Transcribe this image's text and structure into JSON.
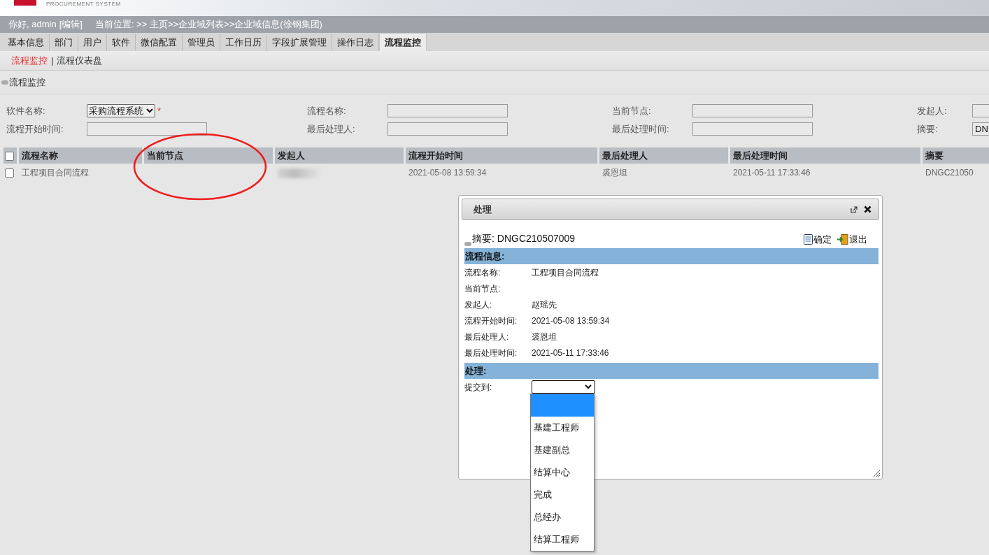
{
  "header": {
    "subtitle": "PROCUREMENT SYSTEM"
  },
  "user_bar": {
    "greeting": "你好, admin",
    "edit_link": "[编辑]",
    "breadcrumb": "当前位置: >> 主页>>企业域列表>>企业域信息(徐钢集团)"
  },
  "tabs": [
    {
      "label": "基本信息",
      "selected": false
    },
    {
      "label": "部门",
      "selected": false
    },
    {
      "label": "用户",
      "selected": false
    },
    {
      "label": "软件",
      "selected": false
    },
    {
      "label": "微信配置",
      "selected": false
    },
    {
      "label": "管理员",
      "selected": false
    },
    {
      "label": "工作日历",
      "selected": false
    },
    {
      "label": "字段扩展管理",
      "selected": false
    },
    {
      "label": "操作日志",
      "selected": false
    },
    {
      "label": "流程监控",
      "selected": true
    }
  ],
  "subnav": {
    "separator": "|",
    "items": [
      {
        "label": "流程监控",
        "selected": true
      },
      {
        "label": "流程仪表盘",
        "selected": false
      }
    ]
  },
  "page_title": "流程监控",
  "filters": [
    {
      "label": "软件名称:",
      "kind": "select",
      "value": "采购流程系统",
      "required": true,
      "required_mark": "*"
    },
    {
      "label": "流程名称:",
      "kind": "input"
    },
    {
      "label": "当前节点:",
      "kind": "input"
    },
    {
      "label": "发起人:",
      "kind": "input"
    },
    {
      "label": "流程开始时间:",
      "kind": "input"
    },
    {
      "label": "最后处理人:",
      "kind": "input"
    },
    {
      "label": "最后处理时间:",
      "kind": "input"
    },
    {
      "label": "摘要:",
      "kind": "input",
      "value": "DN"
    }
  ],
  "table": {
    "header_checked": false,
    "columns": [
      "流程名称",
      "当前节点",
      "发起人",
      "流程开始时间",
      "最后处理人",
      "最后处理时间",
      "摘要"
    ],
    "rows": [
      {
        "checked": false,
        "cells": [
          {
            "kind": "text",
            "text": "工程项目合同流程"
          },
          {
            "kind": "empty"
          },
          {
            "kind": "blurred"
          },
          {
            "kind": "text",
            "text": "2021-05-08 13:59:34"
          },
          {
            "kind": "text",
            "text": "裘恩坦"
          },
          {
            "kind": "text",
            "text": "2021-05-11 17:33:46"
          },
          {
            "kind": "text",
            "text": "DNGC21050"
          }
        ]
      }
    ]
  },
  "annotation": {
    "kind": "ellipse",
    "color": "#ee1c1c"
  },
  "dialog": {
    "title": "处理",
    "summary_label": "摘要:",
    "summary": "DNGC210507009",
    "actions": [
      {
        "kind": "save",
        "label": "确定"
      },
      {
        "kind": "exit",
        "label": "退出"
      }
    ],
    "sections": [
      {
        "title": "流程信息:",
        "fields": [
          {
            "label": "流程名称:",
            "value": "工程项目合同流程"
          },
          {
            "label": "当前节点:"
          },
          {
            "label": "发起人:",
            "value": "赵瑶先"
          },
          {
            "label": "流程开始时间:",
            "value": "2021-05-08 13:59:34"
          },
          {
            "label": "最后处理人:",
            "value": "裘恩坦"
          },
          {
            "label": "最后处理时间:",
            "value": "2021-05-11 17:33:46"
          }
        ]
      },
      {
        "title": "处理:"
      }
    ],
    "submit": {
      "label": "提交到:",
      "expanded": true,
      "options": [
        {
          "selected": true
        },
        {
          "label": "基建工程师",
          "selected": false
        },
        {
          "label": "基建副总",
          "selected": false
        },
        {
          "label": "结算中心",
          "selected": false
        },
        {
          "label": "完成",
          "selected": false
        },
        {
          "label": "总经办",
          "selected": false
        },
        {
          "label": "结算工程师",
          "selected": false
        }
      ]
    }
  }
}
